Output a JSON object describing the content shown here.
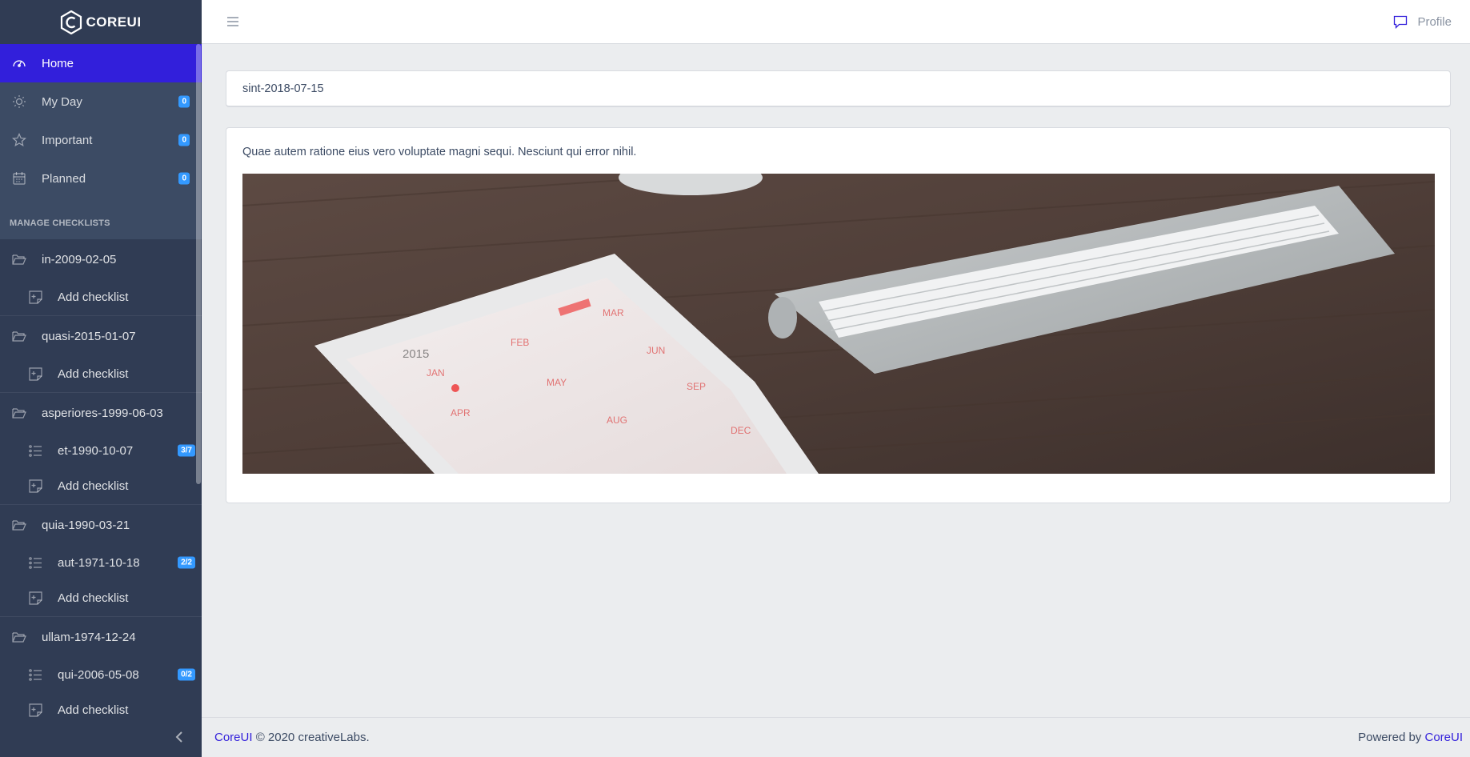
{
  "brand": {
    "name": "COREUI"
  },
  "sidebar": {
    "nav": [
      {
        "label": "Home",
        "icon": "speedometer-icon",
        "active": true
      },
      {
        "label": "My Day",
        "icon": "sun-icon",
        "badge": "0"
      },
      {
        "label": "Important",
        "icon": "star-icon",
        "badge": "0"
      },
      {
        "label": "Planned",
        "icon": "calendar-icon",
        "badge": "0"
      }
    ],
    "section_title": "MANAGE CHECKLISTS",
    "groups": [
      {
        "name": "in-2009-02-05",
        "checklists": [],
        "add_label": "Add checklist"
      },
      {
        "name": "quasi-2015-01-07",
        "checklists": [],
        "add_label": "Add checklist"
      },
      {
        "name": "asperiores-1999-06-03",
        "checklists": [
          {
            "name": "et-1990-10-07",
            "badge": "3/7"
          }
        ],
        "add_label": "Add checklist"
      },
      {
        "name": "quia-1990-03-21",
        "checklists": [
          {
            "name": "aut-1971-10-18",
            "badge": "2/2"
          }
        ],
        "add_label": "Add checklist"
      },
      {
        "name": "ullam-1974-12-24",
        "checklists": [
          {
            "name": "qui-2006-05-08",
            "badge": "0/2"
          }
        ],
        "add_label": "Add checklist"
      }
    ]
  },
  "header": {
    "profile_label": "Profile"
  },
  "main": {
    "title_card": "sint-2018-07-15",
    "description": "Quae autem ratione eius vero voluptate magni sequi. Nesciunt qui error nihil.",
    "photo_calendar_labels": {
      "year": "2015",
      "months": [
        "JAN",
        "FEB",
        "MAR",
        "APR",
        "MAY",
        "JUN",
        "AUG",
        "SEP",
        "DEC"
      ]
    }
  },
  "footer": {
    "brand_link": "CoreUI",
    "copyright": "© 2020 creativeLabs.",
    "powered_by": "Powered by",
    "powered_link": "CoreUI"
  },
  "colors": {
    "sidebar_bg": "#3c4b64",
    "active_bg": "#321fdb",
    "badge_bg": "#3399ff",
    "page_bg": "#ebedef"
  }
}
